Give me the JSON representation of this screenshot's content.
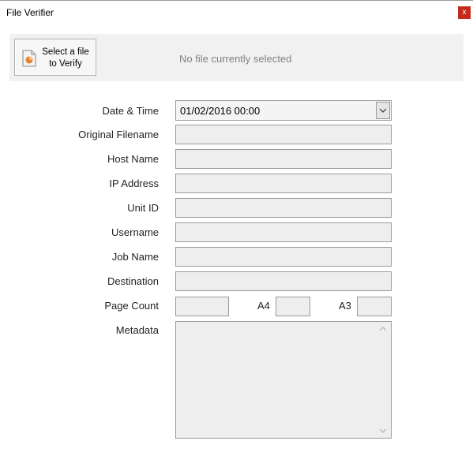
{
  "window": {
    "title": "File Verifier",
    "close_label": "x"
  },
  "select_panel": {
    "button_label": "Select a file\nto Verify",
    "status_text": "No file currently selected"
  },
  "form": {
    "date_time": {
      "label": "Date & Time",
      "value": "01/02/2016 00:00"
    },
    "original_filename": {
      "label": "Original Filename",
      "value": ""
    },
    "host_name": {
      "label": "Host Name",
      "value": ""
    },
    "ip_address": {
      "label": "IP Address",
      "value": ""
    },
    "unit_id": {
      "label": "Unit ID",
      "value": ""
    },
    "username": {
      "label": "Username",
      "value": ""
    },
    "job_name": {
      "label": "Job Name",
      "value": ""
    },
    "destination": {
      "label": "Destination",
      "value": ""
    },
    "page_count": {
      "label": "Page Count",
      "value": "",
      "a4_label": "A4",
      "a4_value": "",
      "a3_label": "A3",
      "a3_value": ""
    },
    "metadata": {
      "label": "Metadata",
      "value": ""
    }
  },
  "colors": {
    "close_button": "#c42b1c",
    "field_background": "#eeeeee",
    "panel_background": "#f1f1f1",
    "status_text": "#808080"
  },
  "icons": {
    "file": "document-chart-icon",
    "dropdown": "chevron-down-icon",
    "scroll_up": "chevron-up-icon",
    "scroll_down": "chevron-down-icon"
  }
}
